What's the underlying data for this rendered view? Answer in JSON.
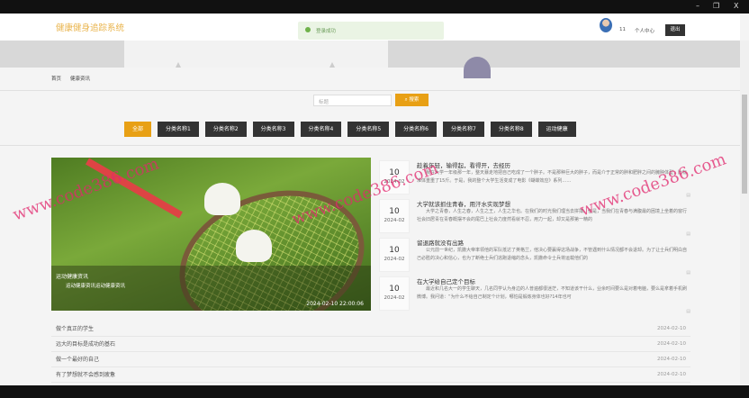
{
  "window": {
    "minimize": "–",
    "restore": "❐",
    "close": "X"
  },
  "header": {
    "logo": "健康健身追踪系统",
    "toast": "登录成功",
    "username": "11",
    "user_center": "个人中心",
    "logout": "退出"
  },
  "breadcrumb": {
    "home": "首页",
    "current": "健康资讯"
  },
  "search": {
    "placeholder": "标题",
    "button": "搜索"
  },
  "categories": [
    "全部",
    "分类名称1",
    "分类名称2",
    "分类名称3",
    "分类名称4",
    "分类名称5",
    "分类名称6",
    "分类名称7",
    "分类名称8",
    "运动健康"
  ],
  "featured": {
    "title": "运动健康资讯",
    "subtitle": "运动健康资讯运动健康资讯",
    "time": "2024-02-10 22:00:06"
  },
  "articles": [
    {
      "day": "10",
      "ym": "2024-02",
      "title": "趁着年轻，输得起，看得开，去经历",
      "excerpt": "我在大学一年级那一年，整天暴走地把自己吃成了一个胖子。不是那种巨大的胖子，而是介于正常的胖和肥胖之间的臃肿体型，比标准体重重了15斤。于是，我的整个大学生活变成了电影《蝴蝶效应》系列……"
    },
    {
      "day": "10",
      "ym": "2024-02",
      "title": "大学就该抓住青春，用汗水实现梦想",
      "excerpt": "大学之青春，人生之春，人生之王，人生之华也。在我们的时光我们理当去拼搏。但是，当我们在青春与满腹最的困境上坐着的窗行社会旧居青在青春概摆不会的尾巴上社会力度然看就不忍，用力一起，却又是那第一精的"
    },
    {
      "day": "10",
      "ym": "2024-02",
      "title": "留退路就没有出路",
      "excerpt": "公元前一世纪，凯撒大帝率领他的军队抵达了英格兰，他决心要赢得这场战争，不管遇到什么情况都不会退却。为了让士兵们明白自己必胜的决心和信心，也为了断绝士兵们逃跑退缩的念头，凯撒命令士兵将运载他们的"
    },
    {
      "day": "10",
      "ym": "2024-02",
      "title": "在大学给自己定个目标",
      "excerpt": "最近和几名大一的学生聊天，几名同学认为身边的人普遍都很迷茫，不知道该干什么，业余时间要么是对着电脑，要么是拿着手机刷微博。我问道：“为什么不给自己制定个计划，哪怕是锻炼身体也好?14年也可"
    }
  ],
  "list": [
    {
      "title": "做个真正的学生",
      "date": "2024-02-10"
    },
    {
      "title": "远大的目标是成功的基石",
      "date": "2024-02-10"
    },
    {
      "title": "做一个最好的自己",
      "date": "2024-02-10"
    },
    {
      "title": "有了梦想就不会感到疲惫",
      "date": "2024-02-10"
    }
  ],
  "watermark": "www.code386.com",
  "colors": {
    "accent": "#e8a015",
    "logo": "#e9b34a",
    "dark_button": "#333333"
  }
}
